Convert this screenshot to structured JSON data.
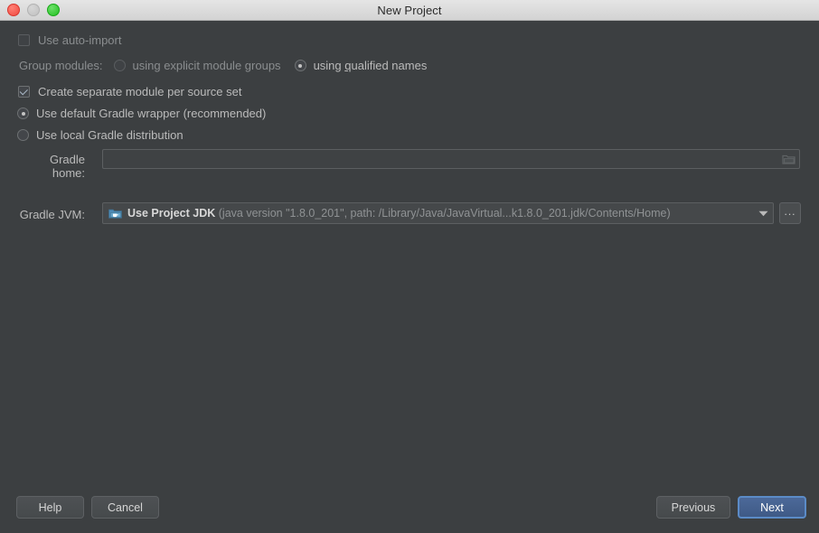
{
  "window": {
    "title": "New Project",
    "traffic_lights": [
      "close-button",
      "minimize-button",
      "zoom-button"
    ]
  },
  "colors": {
    "background": "#3c3f41",
    "titlebar": "#d8d8d8",
    "text": "#bbbbbb",
    "muted_text": "#8f9294",
    "accent": "#5b8bc7",
    "default_button_fill": "#4c6999"
  },
  "form": {
    "auto_import": {
      "label": "Use auto-import",
      "checked": false,
      "enabled": false
    },
    "group_modules": {
      "label": "Group modules:",
      "options": [
        {
          "label_before": "using explicit module ",
          "mnemonic": "g",
          "label_after": "roups",
          "selected": false,
          "enabled": false
        },
        {
          "label_before": "using ",
          "mnemonic": "q",
          "label_after": "ualified names",
          "selected": true,
          "enabled": true
        }
      ]
    },
    "separate_module": {
      "label": "Create separate module per source set",
      "checked": true
    },
    "gradle_wrapper": {
      "label": "Use default Gradle wrapper (recommended)",
      "selected": true
    },
    "local_distribution": {
      "label": "Use local Gradle distribution",
      "selected": false
    },
    "gradle_home": {
      "label": "Gradle home:",
      "value": "",
      "placeholder": "",
      "browse_icon": "folder-icon",
      "enabled": false
    },
    "gradle_jvm": {
      "label": "Gradle JVM:",
      "icon": "jdk-folder-icon",
      "value_primary": "Use Project JDK",
      "value_detail": "(java version \"1.8.0_201\", path: /Library/Java/JavaVirtual...k1.8.0_201.jdk/Contents/Home)",
      "dropdown_icon": "chevron-down-icon",
      "browse_label": "..."
    }
  },
  "footer": {
    "help_label": "Help",
    "cancel_label": "Cancel",
    "previous_label": "Previous",
    "next_label": "Next"
  }
}
